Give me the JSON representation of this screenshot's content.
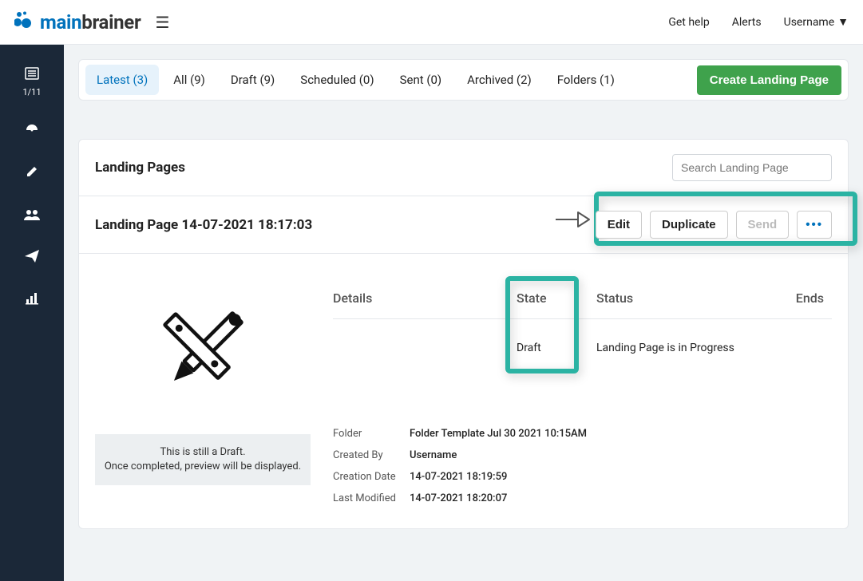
{
  "topbar": {
    "logo_main": "main",
    "logo_brainer": "brainer",
    "help": "Get help",
    "alerts": "Alerts",
    "username": "Username"
  },
  "sidebar": {
    "step": "1/11"
  },
  "tabs": {
    "latest": "Latest (3)",
    "all": "All (9)",
    "draft": "Draft (9)",
    "scheduled": "Scheduled (0)",
    "sent": "Sent (0)",
    "archived": "Archived (2)",
    "folders": "Folders (1)",
    "create": "Create Landing Page"
  },
  "content": {
    "title": "Landing Pages",
    "search_placeholder": "Search Landing Page"
  },
  "item": {
    "title": "Landing Page 14-07-2021 18:17:03",
    "edit": "Edit",
    "duplicate": "Duplicate",
    "send": "Send",
    "more": "•••",
    "draft_msg1": "This is still a Draft.",
    "draft_msg2": "Once completed, preview will be displayed.",
    "heads": {
      "details": "Details",
      "state": "State",
      "status": "Status",
      "ends": "Ends"
    },
    "state_val": "Draft",
    "status_val": "Landing Page is in Progress",
    "meta": {
      "folder_label": "Folder",
      "folder_val": "Folder Template Jul 30 2021 10:15AM",
      "created_by_label": "Created By",
      "created_by_val": "Username",
      "creation_date_label": "Creation Date",
      "creation_date_val": "14-07-2021 18:19:59",
      "last_modified_label": "Last Modified",
      "last_modified_val": "14-07-2021 18:20:07"
    }
  }
}
